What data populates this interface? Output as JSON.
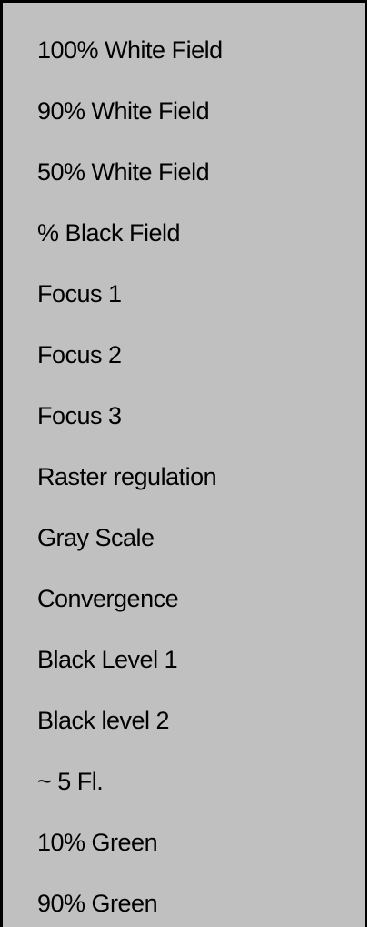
{
  "menu": {
    "items": [
      {
        "label": "100% White Field"
      },
      {
        "label": "90% White Field"
      },
      {
        "label": "50% White Field"
      },
      {
        "label": "% Black Field"
      },
      {
        "label": "Focus 1"
      },
      {
        "label": "Focus 2"
      },
      {
        "label": "Focus 3"
      },
      {
        "label": "Raster regulation"
      },
      {
        "label": "Gray Scale"
      },
      {
        "label": "Convergence"
      },
      {
        "label": "Black Level 1"
      },
      {
        "label": "Black level 2"
      },
      {
        "label": "~ 5 Fl."
      },
      {
        "label": "10% Green"
      },
      {
        "label": "90% Green"
      }
    ]
  },
  "colors": {
    "panel_background": "#c0c0c0",
    "border": "#000000",
    "text": "#000000"
  }
}
